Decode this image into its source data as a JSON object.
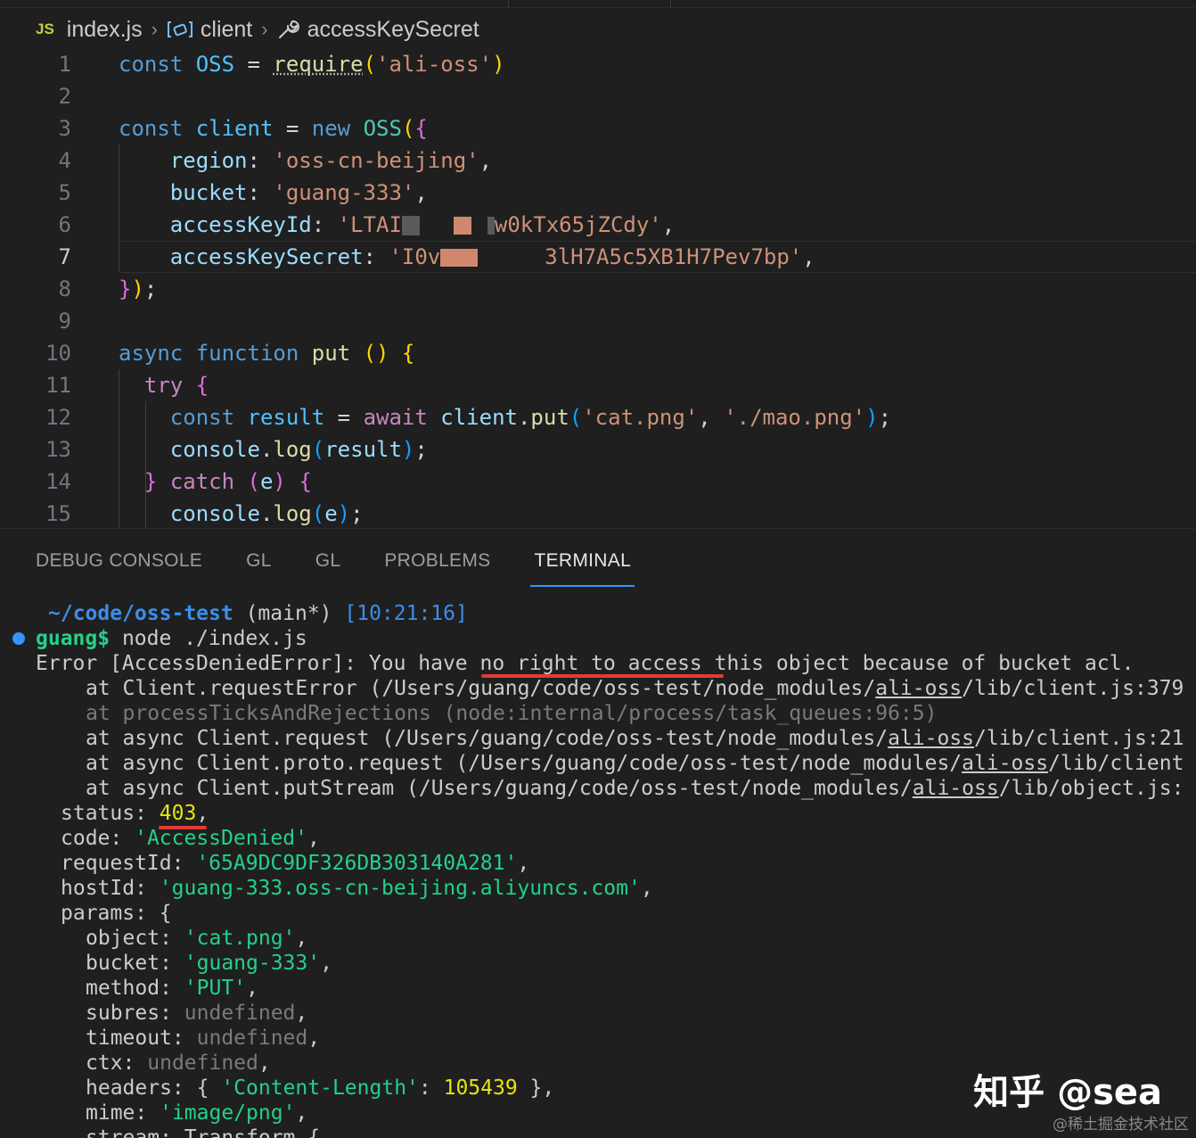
{
  "breadcrumb": {
    "file": "index.js",
    "file_badge": "JS",
    "symbol1": "client",
    "symbol2": "accessKeySecret"
  },
  "editor": {
    "line_numbers": [
      "1",
      "2",
      "3",
      "4",
      "5",
      "6",
      "7",
      "8",
      "9",
      "10",
      "11",
      "12",
      "13",
      "14",
      "15"
    ],
    "active_line": "7",
    "region_value": "'oss-cn-beijing'",
    "bucket_value": "'guang-333'",
    "access_key_id_prefix": "'LTAI",
    "access_key_id_suffix": "w0kTx65jZCdy'",
    "access_key_secret_prefix": "'I0v",
    "access_key_secret_suffix": "3lH7A5c5XB1H7Pev7bp'"
  },
  "panel": {
    "tabs": [
      "DEBUG CONSOLE",
      "GL",
      "GL",
      "PROBLEMS",
      "TERMINAL"
    ],
    "active_tab": "TERMINAL"
  },
  "terminal": {
    "cwd": "~/code/oss-test",
    "branch": "(main*)",
    "time": "[10:21:16]",
    "prompt_user": "guang$",
    "command": "node ./index.js",
    "error_head": "Error [AccessDeniedError]: You have",
    "error_highlight": "no right to access",
    "error_tail": "this object because of bucket acl.",
    "stack": [
      {
        "pre": "at Client.requestError (/Users/guang/code/oss-test/node_modules/",
        "lib": "ali-oss",
        "post": "/lib/client.js:379"
      },
      {
        "pre": "at processTicksAndRejections (node:internal/process/task_queues:96:5)",
        "lib": "",
        "post": ""
      },
      {
        "pre": "at async Client.request (/Users/guang/code/oss-test/node_modules/",
        "lib": "ali-oss",
        "post": "/lib/client.js:21"
      },
      {
        "pre": "at async Client.proto.request (/Users/guang/code/oss-test/node_modules/",
        "lib": "ali-oss",
        "post": "/lib/client"
      },
      {
        "pre": "at async Client.putStream (/Users/guang/code/oss-test/node_modules/",
        "lib": "ali-oss",
        "post": "/lib/object.js:"
      }
    ],
    "status": "403",
    "code": "'AccessDenied'",
    "request_id": "'65A9DC9DF326DB303140A281'",
    "host_id": "'guang-333.oss-cn-beijing.aliyuncs.com'",
    "params_object": "'cat.png'",
    "params_bucket": "'guang-333'",
    "params_method": "'PUT'",
    "undefined": "undefined",
    "content_length_key": "'Content-Length'",
    "content_length": "105439",
    "mime": "'image/png'",
    "stream_line": "stream: Transform {"
  },
  "watermark": {
    "main": "知乎 @sea",
    "sub": "@稀土掘金技术社区"
  },
  "colors": {
    "background": "#1f1f1f",
    "accent": "#3794ff",
    "annotation": "#e53935"
  }
}
